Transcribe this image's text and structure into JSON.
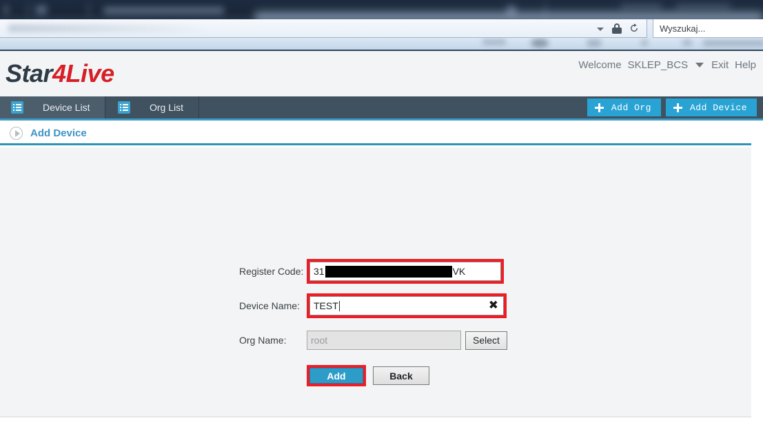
{
  "browser": {
    "search_placeholder": "Wyszukaj...",
    "lock_icon": "lock-icon",
    "reload_icon": "reload-icon",
    "dropdown_icon": "chevron-down-icon"
  },
  "header": {
    "logo_part1": "Star",
    "logo_part2": "4Live",
    "welcome_label": "Welcome",
    "username": "SKLEP_BCS",
    "exit_label": "Exit",
    "help_label": "Help"
  },
  "nav": {
    "tabs": [
      {
        "label": "Device List",
        "icon": "list-icon",
        "active": true
      },
      {
        "label": "Org List",
        "icon": "list-icon",
        "active": false
      }
    ],
    "actions": [
      {
        "label": "Add Org",
        "icon": "plus-icon"
      },
      {
        "label": "Add Device",
        "icon": "plus-icon"
      }
    ]
  },
  "breadcrumb": {
    "icon": "play-circle-icon",
    "label": "Add Device"
  },
  "form": {
    "register_code": {
      "label": "Register Code:",
      "value_prefix": "31",
      "value_redacted": true,
      "value_suffix": "VK",
      "highlighted": true
    },
    "device_name": {
      "label": "Device Name:",
      "value": "TEST",
      "clear_icon": "close-icon",
      "highlighted": true,
      "focused": true
    },
    "org_name": {
      "label": "Org Name:",
      "value": "root",
      "disabled": true,
      "select_button": "Select"
    },
    "add_button": "Add",
    "back_button": "Back"
  },
  "colors": {
    "brand_red": "#d61f26",
    "nav_bg": "#40515f",
    "accent_blue": "#29a3d4",
    "highlight_red": "#ee1c24",
    "breadcrumb_blue": "#3d93c6"
  }
}
